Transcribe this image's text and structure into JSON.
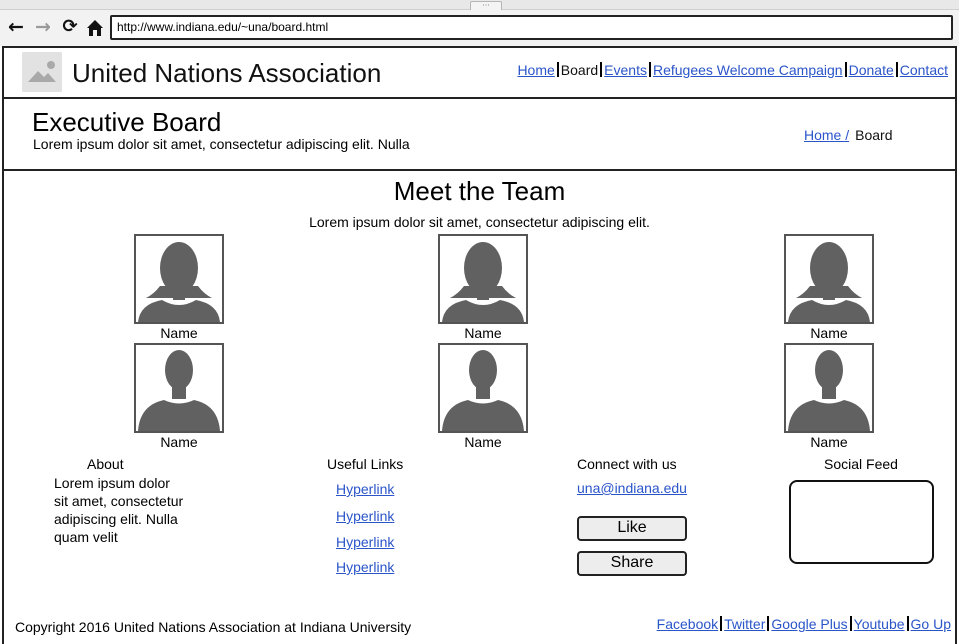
{
  "browser": {
    "url": "http://www.indiana.edu/~una/board.html",
    "icons": [
      "back-arrow-icon",
      "forward-arrow-icon",
      "reload-icon",
      "home-icon"
    ]
  },
  "header": {
    "logo_icon": "image-placeholder-icon",
    "site_title": "United Nations Association",
    "nav": {
      "home": "Home",
      "board": "Board",
      "events": "Events",
      "refugees": "Refugees Welcome Campaign",
      "donate": "Donate",
      "contact": "Contact"
    }
  },
  "page_header": {
    "title": "Executive Board",
    "subtitle": "Lorem ipsum dolor sit amet, consectetur adipiscing elit. Nulla",
    "breadcrumb": {
      "home": "Home /",
      "current": "Board"
    }
  },
  "team": {
    "heading": "Meet the Team",
    "intro": "Lorem ipsum dolor sit amet, consectetur adipiscing elit.",
    "members": [
      {
        "name": "Name",
        "avatar": "female-avatar-icon"
      },
      {
        "name": "Name",
        "avatar": "female-avatar-icon"
      },
      {
        "name": "Name",
        "avatar": "female-avatar-icon"
      },
      {
        "name": "Name",
        "avatar": "male-avatar-icon"
      },
      {
        "name": "Name",
        "avatar": "male-avatar-icon"
      },
      {
        "name": "Name",
        "avatar": "male-avatar-icon"
      }
    ]
  },
  "footer": {
    "about": {
      "heading": "About",
      "text": "Lorem ipsum dolor sit amet, consectetur adipiscing elit. Nulla quam velit"
    },
    "useful_links": {
      "heading": "Useful Links",
      "links": [
        "Hyperlink",
        "Hyperlink",
        "Hyperlink",
        "Hyperlink"
      ]
    },
    "connect": {
      "heading": "Connect with us",
      "email": "una@indiana.edu",
      "like": "Like",
      "share": "Share"
    },
    "social": {
      "heading": "Social Feed"
    },
    "copyright": "Copyright 2016 United Nations Association at Indiana University",
    "links": {
      "facebook": "Facebook",
      "twitter": "Twitter",
      "google_plus": "Google Plus",
      "youtube": "Youtube",
      "go_up": "Go Up"
    }
  },
  "colors": {
    "link": "#2a55c9",
    "avatar": "#616161",
    "border": "#222222"
  }
}
